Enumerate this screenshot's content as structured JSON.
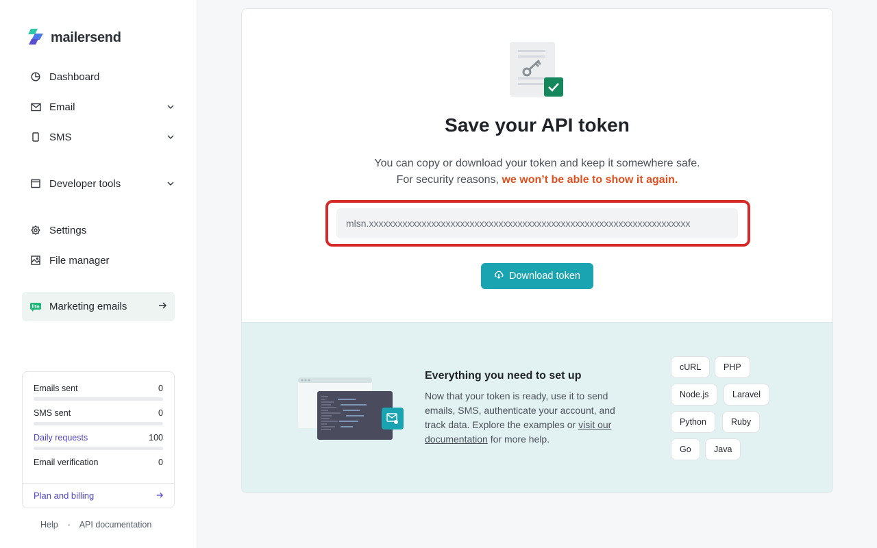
{
  "app": {
    "name": "mailersend"
  },
  "sidebar": {
    "nav": [
      {
        "label": "Dashboard",
        "icon": "pie-chart-icon"
      },
      {
        "label": "Email",
        "icon": "mail-icon"
      },
      {
        "label": "SMS",
        "icon": "phone-icon"
      },
      {
        "label": "Developer tools",
        "icon": "code-window-icon"
      },
      {
        "label": "Settings",
        "icon": "gear-icon"
      },
      {
        "label": "File manager",
        "icon": "image-icon"
      },
      {
        "label": "Marketing emails",
        "icon": "lite-badge-icon",
        "badge": "lite"
      }
    ],
    "stats": [
      {
        "label": "Emails sent",
        "value": "0",
        "progress": 0
      },
      {
        "label": "SMS sent",
        "value": "0",
        "progress": 0
      },
      {
        "label": "Daily requests",
        "value": "100",
        "progress": 0
      },
      {
        "label": "Email verification",
        "value": "0",
        "progress": 0
      }
    ],
    "plan_link": "Plan and billing",
    "footer": {
      "help": "Help",
      "api_docs": "API documentation"
    }
  },
  "main": {
    "title": "Save your API token",
    "subtitle_line1": "You can copy or download your token and keep it somewhere safe.",
    "subtitle_line2_prefix": "For security reasons, ",
    "subtitle_line2_warning": "we won’t be able to show it again.",
    "token_value": "mlsn.xxxxxxxxxxxxxxxxxxxxxxxxxxxxxxxxxxxxxxxxxxxxxxxxxxxxxxxxxxxxxxxxxxx",
    "download_label": "Download token",
    "setup": {
      "title": "Everything you need to set up",
      "text_before": "Now that your token is ready, use it to send emails, SMS, authenticate your account, and track data. Explore the examples or ",
      "link_text": "visit our documentation",
      "text_after": " for more help.",
      "languages": [
        "cURL",
        "PHP",
        "Node.js",
        "Laravel",
        "Python",
        "Ruby",
        "Go",
        "Java"
      ]
    }
  },
  "colors": {
    "accent": "#1aa3b1",
    "warning": "#e0501f",
    "highlight_border": "#d62a2a",
    "link": "#4f46c8",
    "setup_bg": "#e2f1f2",
    "success": "#15875c"
  }
}
